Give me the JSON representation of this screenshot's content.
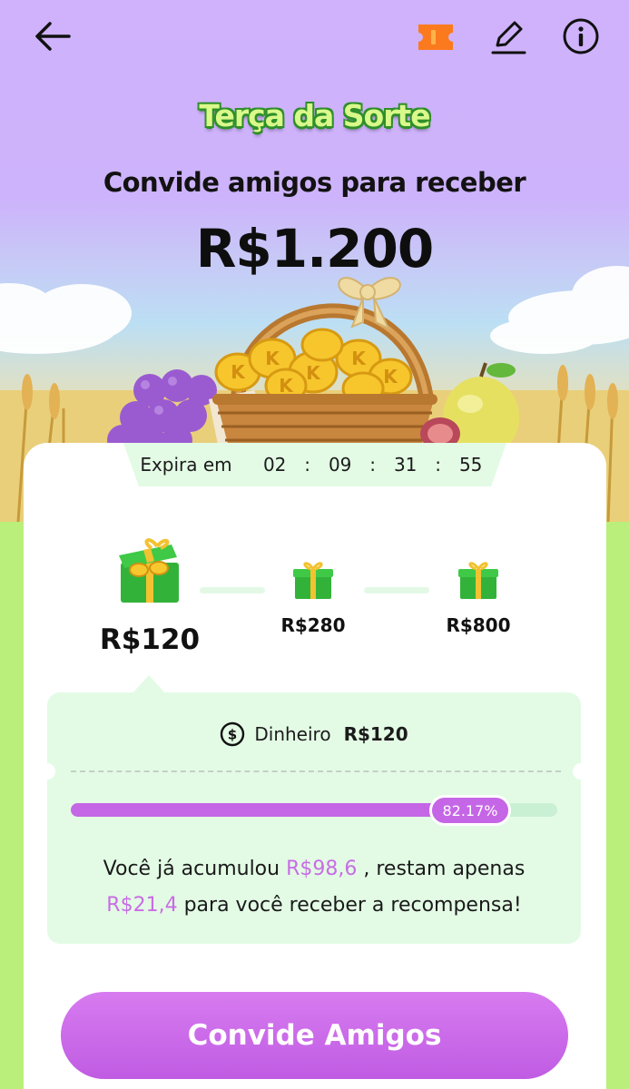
{
  "header": {
    "back_icon": "arrow-left-icon",
    "ticket_icon": "ticket-icon",
    "edit_icon": "pencil-icon",
    "info_icon": "info-icon"
  },
  "hero": {
    "brand": "Terça da Sorte",
    "subtitle": "Convide amigos para receber",
    "amount": "R$1.200"
  },
  "countdown": {
    "label": "Expira em",
    "days": "02",
    "hours": "09",
    "minutes": "31",
    "seconds": "55",
    "separator": ":"
  },
  "milestones": [
    {
      "label": "R$120",
      "icon": "gift-box-coins-icon",
      "active": true
    },
    {
      "label": "R$280",
      "icon": "gift-box-icon",
      "active": false
    },
    {
      "label": "R$800",
      "icon": "gift-box-icon",
      "active": false
    }
  ],
  "reward": {
    "icon": "dollar-circle-icon",
    "type": "Dinheiro",
    "amount": "R$120",
    "progress_percent": 82.17,
    "progress_label": "82.17%",
    "msg_part1": "Você já acumulou",
    "accumulated": "R$98,6",
    "msg_part2": ", restam apenas",
    "remaining": "R$21,4",
    "msg_part3": "para você receber a recompensa!"
  },
  "cta": {
    "label": "Convide Amigos"
  },
  "colors": {
    "accent_purple": "#c566e6",
    "panel_green": "#e3fbe5",
    "page_green": "#b9ef7a",
    "hero_lavender": "#cfb2fb"
  }
}
